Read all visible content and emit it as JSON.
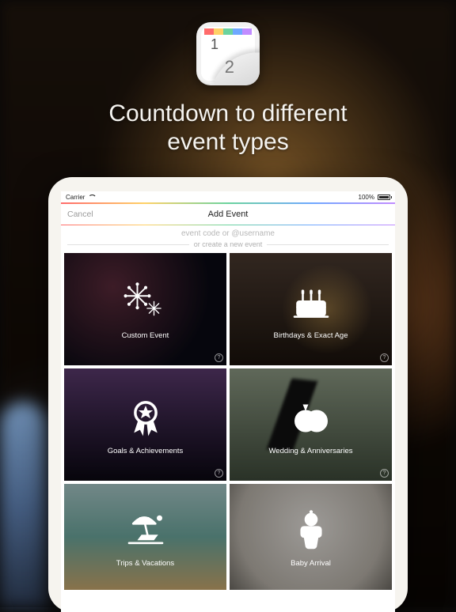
{
  "promo": {
    "headline_line1": "Countdown to different",
    "headline_line2": "event types",
    "app_icon_digit_1": "1",
    "app_icon_digit_2": "2"
  },
  "statusbar": {
    "carrier": "Carrier",
    "battery_pct": "100%"
  },
  "nav": {
    "cancel": "Cancel",
    "title": "Add Event"
  },
  "search": {
    "placeholder": "event code or @username",
    "divider_label": "or create a new event"
  },
  "tiles": [
    {
      "id": "custom",
      "label": "Custom Event",
      "icon": "fireworks-icon"
    },
    {
      "id": "birthday",
      "label": "Birthdays & Exact Age",
      "icon": "cake-icon"
    },
    {
      "id": "goals",
      "label": "Goals & Achievements",
      "icon": "ribbon-icon"
    },
    {
      "id": "wedding",
      "label": "Wedding & Anniversaries",
      "icon": "rings-icon"
    },
    {
      "id": "trips",
      "label": "Trips & Vacations",
      "icon": "beach-icon"
    },
    {
      "id": "baby",
      "label": "Baby Arrival",
      "icon": "baby-icon"
    }
  ],
  "help_glyph": "?"
}
